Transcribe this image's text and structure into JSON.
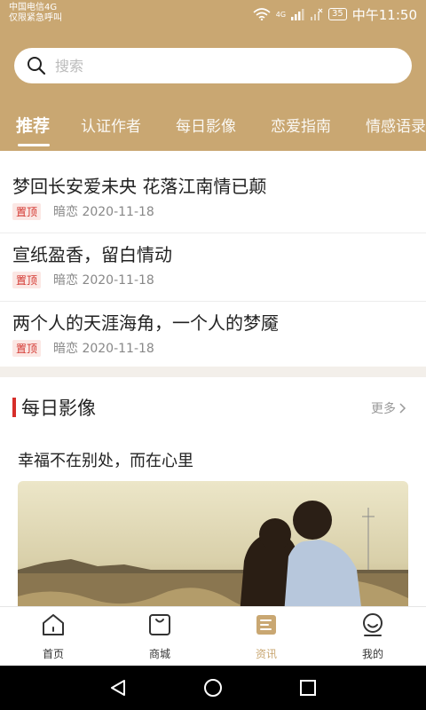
{
  "status_bar": {
    "carrier_line1": "中国电信4G",
    "carrier_line2": "仅限紧急呼叫",
    "network": "4G",
    "battery": "35",
    "time": "中午11:50"
  },
  "search": {
    "placeholder": "搜索",
    "value": ""
  },
  "tabs": [
    {
      "label": "推荐",
      "active": true
    },
    {
      "label": "认证作者",
      "active": false
    },
    {
      "label": "每日影像",
      "active": false
    },
    {
      "label": "恋爱指南",
      "active": false
    },
    {
      "label": "情感语录",
      "active": false
    }
  ],
  "articles": [
    {
      "title": "梦回长安爱未央 花落江南情已颠",
      "badge": "置顶",
      "meta": "暗恋 2020-11-18"
    },
    {
      "title": "宣纸盈香，留白情动",
      "badge": "置顶",
      "meta": "暗恋 2020-11-18"
    },
    {
      "title": "两个人的天涯海角，一个人的梦魇",
      "badge": "置顶",
      "meta": "暗恋 2020-11-18"
    }
  ],
  "daily_section": {
    "title": "每日影像",
    "more": "更多",
    "caption": "幸福不在别处，而在心里"
  },
  "bottom_nav": [
    {
      "label": "首页",
      "icon": "home-icon",
      "active": false
    },
    {
      "label": "商城",
      "icon": "shopping-bag-icon",
      "active": false
    },
    {
      "label": "资讯",
      "icon": "news-icon",
      "active": true
    },
    {
      "label": "我的",
      "icon": "profile-icon",
      "active": false
    }
  ],
  "colors": {
    "header": "#c9a772",
    "accent_red": "#d62e2a",
    "active_nav": "#c9a772"
  }
}
